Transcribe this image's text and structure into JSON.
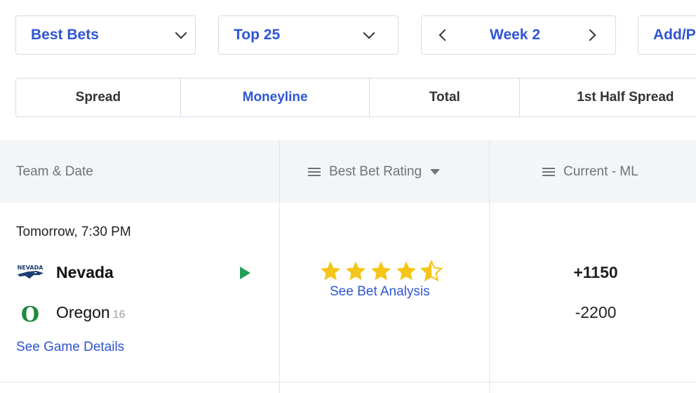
{
  "filters": {
    "bets_label": "Best Bets",
    "rank_label": "Top 25",
    "week_label": "Week 2",
    "add_label": "Add/P"
  },
  "tabs": [
    {
      "label": "Spread",
      "active": false
    },
    {
      "label": "Moneyline",
      "active": true
    },
    {
      "label": "Total",
      "active": false
    },
    {
      "label": "1st Half Spread",
      "active": false
    }
  ],
  "table": {
    "headers": {
      "team_date": "Team & Date",
      "rating": "Best Bet Rating",
      "current": "Current - ML"
    },
    "rows": [
      {
        "date": "Tomorrow, 7:30 PM",
        "away_team": "Nevada",
        "away_logo_text": "NEVADA",
        "home_team": "Oregon",
        "home_rank": "16",
        "home_logo_text": "O",
        "details_link": "See Game Details",
        "rating_stars": 4.5,
        "analysis_link": "See Bet Analysis",
        "away_odds": "+1150",
        "home_odds": "-2200"
      }
    ]
  },
  "colors": {
    "accent": "#2f55d4",
    "star": "#f5c518",
    "play": "#22a05a",
    "oregon_green": "#1f8a3c",
    "nevada_navy": "#1c3e6e"
  },
  "icons": {
    "dropdown": "chevron-down-icon",
    "prev": "chevron-left-icon",
    "next": "chevron-right-icon",
    "sort": "hamburger-icon",
    "caret": "caret-down-icon",
    "play": "play-icon",
    "star": "star-icon"
  }
}
